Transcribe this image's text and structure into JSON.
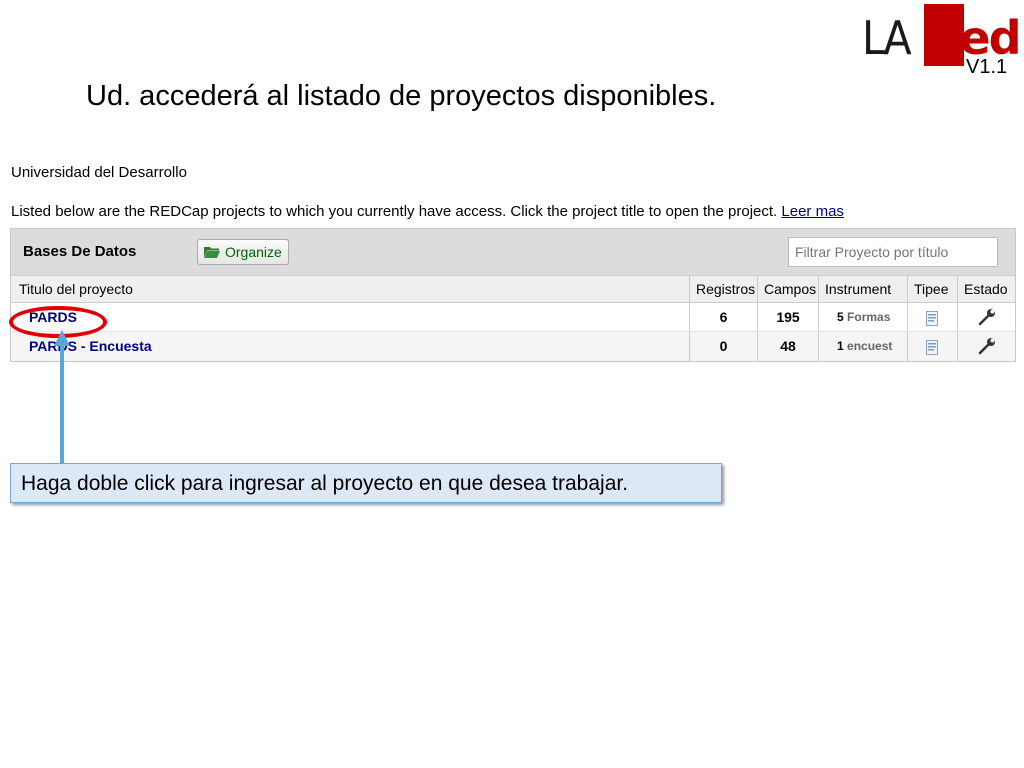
{
  "logo": {
    "part1": "LA",
    "part2": "Red",
    "version": "V1.1"
  },
  "slide_title": "Ud. accederá al listado de proyectos disponibles.",
  "institution": "Universidad del Desarrollo",
  "description": "Listed below are the REDCap projects to which you currently have access. Click the project title to open the project.",
  "read_more": "Leer mas",
  "panel": {
    "title": "Bases De Datos",
    "organize_label": "Organize",
    "filter_placeholder": "Filtrar Proyecto por título"
  },
  "columns": [
    "Titulo del proyecto",
    "Registros",
    "Campos",
    "Instrument",
    "Tipee",
    "Estado"
  ],
  "rows": [
    {
      "title": "PARDS",
      "records": "6",
      "fields": "195",
      "instr_count": "5",
      "instr_word": "Formas"
    },
    {
      "title": "PARDS - Encuesta",
      "records": "0",
      "fields": "48",
      "instr_count": "1",
      "instr_word": "encuest"
    }
  ],
  "callout": "Haga doble click para ingresar al proyecto en que desea trabajar.",
  "colors": {
    "link": "#000080",
    "highlight": "#e00000",
    "callout_bg": "#dde8f6",
    "brand_red": "#c00000"
  }
}
